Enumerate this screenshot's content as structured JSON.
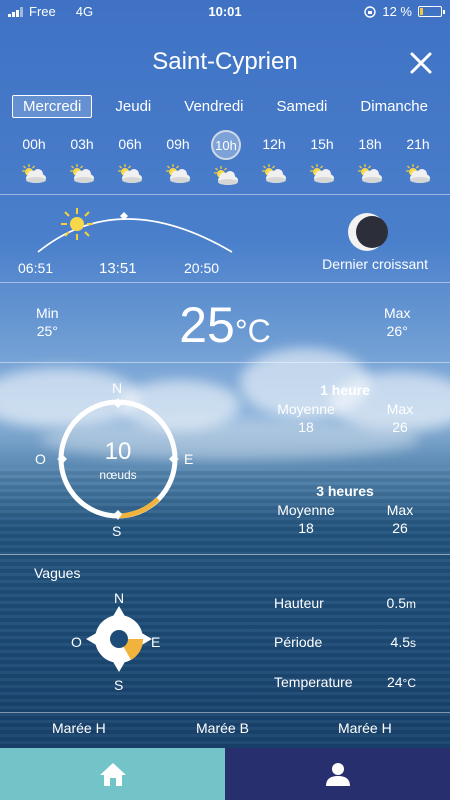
{
  "status_bar": {
    "carrier": "Free",
    "network": "4G",
    "time": "10:01",
    "battery": "12 %"
  },
  "header": {
    "city": "Saint-Cyprien"
  },
  "days": [
    "Mercredi",
    "Jeudi",
    "Vendredi",
    "Samedi",
    "Dimanche"
  ],
  "selected_day": "Mercredi",
  "hours": [
    "00h",
    "03h",
    "06h",
    "09h",
    "10h",
    "12h",
    "15h",
    "18h",
    "21h"
  ],
  "selected_hour": "10h",
  "sun": {
    "sunrise": "06:51",
    "noon": "13:51",
    "sunset": "20:50"
  },
  "moon": {
    "phase": "Dernier croissant"
  },
  "temperature": {
    "min_label": "Min",
    "min_value": "25°",
    "current": "25",
    "unit": "°C",
    "max_label": "Max",
    "max_value": "26°"
  },
  "wind": {
    "speed": "10",
    "unit": "nœuds",
    "compass": {
      "n": "N",
      "e": "E",
      "s": "S",
      "o": "O"
    },
    "direction_deg": 180,
    "one_hour": {
      "title": "1 heure",
      "avg_label": "Moyenne",
      "avg": "18",
      "max_label": "Max",
      "max": "26"
    },
    "three_hours": {
      "title": "3 heures",
      "avg_label": "Moyenne",
      "avg": "18",
      "max_label": "Max",
      "max": "26"
    }
  },
  "waves": {
    "label": "Vagues",
    "compass": {
      "n": "N",
      "e": "E",
      "s": "S",
      "o": "O"
    },
    "height_label": "Hauteur",
    "height_value": "0.5",
    "height_unit": "m",
    "period_label": "Période",
    "period_value": "4.5",
    "period_unit": "s",
    "temp_label": "Temperature",
    "temp_value": "24",
    "temp_unit": "°C"
  },
  "tides": [
    "Marée H",
    "Marée B",
    "Marée H"
  ],
  "tabs": {
    "home_icon": "home-icon",
    "user_icon": "user-icon"
  },
  "colors": {
    "accent_yellow": "#f0b43c",
    "tab_home": "#72c4c9",
    "tab_user": "#272f6e"
  }
}
